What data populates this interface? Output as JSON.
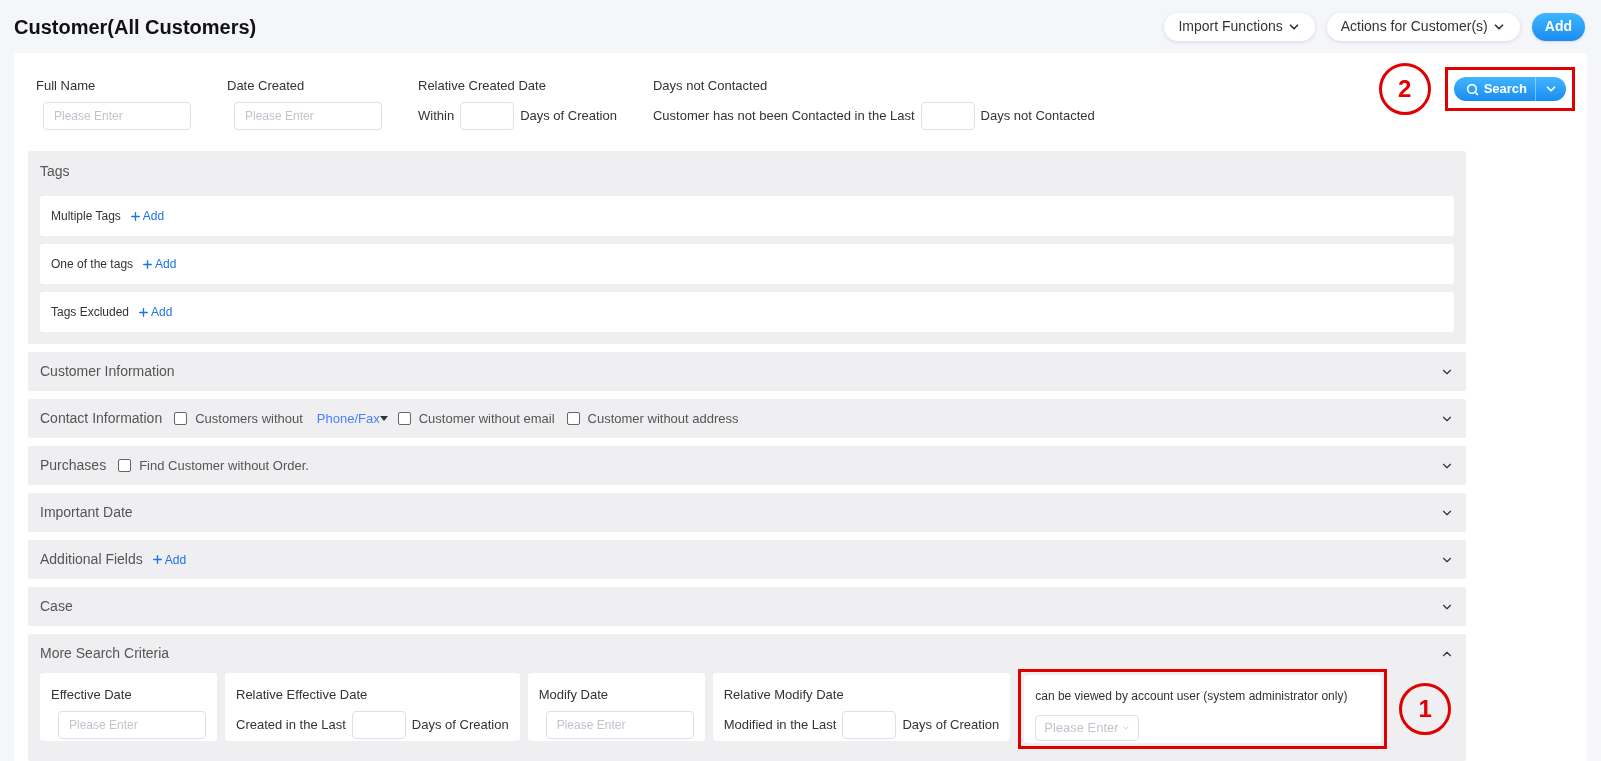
{
  "page_title": "Customer(All Customers)",
  "header_buttons": [
    {
      "label": "Import Functions",
      "kind": "dropdown"
    },
    {
      "label": "Actions for Customer(s)",
      "kind": "dropdown"
    },
    {
      "label": "Add",
      "kind": "primary"
    }
  ],
  "filters": [
    {
      "kind": "field",
      "label": "Full Name",
      "placeholder": "Please Enter"
    },
    {
      "kind": "field",
      "label": "Date Created",
      "placeholder": "Please Enter"
    },
    {
      "kind": "inline",
      "label": "Relative Created Date",
      "before": "Within",
      "after": "Days of Creation"
    },
    {
      "kind": "inline",
      "label": "Days not Contacted",
      "before": "Customer has not been Contacted in the Last",
      "after": "Days not Contacted"
    }
  ],
  "search_button": {
    "label": "Search",
    "callout": "2"
  },
  "sections": [
    {
      "kind": "group",
      "title": "Tags",
      "rows": [
        {
          "label": "Multiple Tags",
          "action": "Add"
        },
        {
          "label": "One of the tags",
          "action": "Add"
        },
        {
          "label": "Tags Excluded",
          "action": "Add"
        }
      ]
    },
    {
      "kind": "collapsible",
      "title": "Customer Information",
      "expanded": false
    },
    {
      "kind": "collapsible",
      "title": "Contact Information",
      "expanded": false,
      "options": [
        {
          "kind": "checkbox",
          "label": "Customers without",
          "checked": false
        },
        {
          "kind": "dropdown-link",
          "label": "Phone/Fax"
        },
        {
          "kind": "checkbox",
          "label": "Customer without email",
          "checked": false
        },
        {
          "kind": "checkbox",
          "label": "Customer without address",
          "checked": false
        }
      ]
    },
    {
      "kind": "collapsible",
      "title": "Purchases",
      "expanded": false,
      "options": [
        {
          "kind": "checkbox",
          "label": "Find Customer without Order.",
          "checked": false
        }
      ]
    },
    {
      "kind": "collapsible",
      "title": "Important Date",
      "expanded": false
    },
    {
      "kind": "collapsible",
      "title": "Additional Fields",
      "expanded": false,
      "action": "Add"
    },
    {
      "kind": "collapsible",
      "title": "Case",
      "expanded": false
    },
    {
      "kind": "collapsible",
      "title": "More Search Criteria",
      "expanded": true,
      "cards": [
        {
          "kind": "field",
          "label": "Effective Date",
          "placeholder": "Please Enter"
        },
        {
          "kind": "inline",
          "label": "Relative Effective Date",
          "before": "Created in the Last",
          "after": "Days of Creation"
        },
        {
          "kind": "field",
          "label": "Modify Date",
          "placeholder": "Please Enter"
        },
        {
          "kind": "inline",
          "label": "Relative Modify Date",
          "before": "Modified in the Last",
          "after": "Days of Creation"
        },
        {
          "kind": "select",
          "label": "can be viewed by account user (system administrator only)",
          "placeholder": "Please Enter",
          "callout": "1"
        }
      ]
    }
  ]
}
